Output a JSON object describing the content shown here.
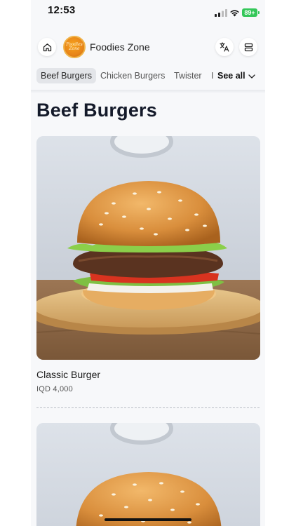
{
  "status_bar": {
    "time": "12:53",
    "battery": "89+",
    "battery_color": "#34c759"
  },
  "header": {
    "brand_name": "Foodies Zone",
    "logo_text": "Foodies Zone",
    "icons": [
      "home-icon",
      "translate-icon",
      "menu-icon"
    ]
  },
  "categories": {
    "items": [
      "Beef Burgers",
      "Chicken Burgers",
      "Twister",
      "I"
    ],
    "active": "Beef Burgers",
    "see_all_label": "See all"
  },
  "section": {
    "title": "Beef Burgers"
  },
  "products": [
    {
      "name": "Classic Burger",
      "price": "IQD 4,000",
      "image": "burger-photo"
    },
    {
      "name": "",
      "price": "",
      "image": "burger-photo"
    }
  ],
  "colors": {
    "background": "#f7f8fa",
    "title": "#141a2a",
    "active_tab_bg": "#e3e5e9"
  }
}
